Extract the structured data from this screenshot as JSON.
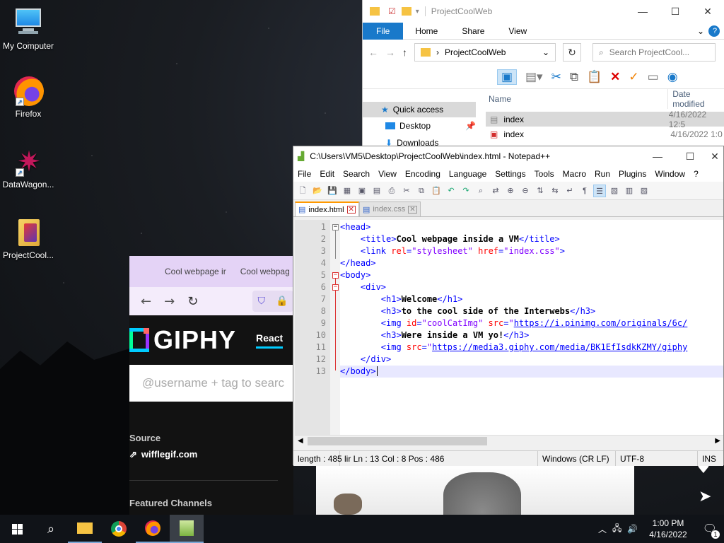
{
  "desktop": {
    "icons": [
      {
        "label": "My Computer"
      },
      {
        "label": "Firefox"
      },
      {
        "label": "DataWagon..."
      },
      {
        "label": "ProjectCool..."
      }
    ]
  },
  "firefox": {
    "tabs": [
      "Cool webpage ir",
      "Cool webpag"
    ],
    "giphy_logo": "GIPHY",
    "react_label": "React",
    "search_placeholder": "@username + tag to searc",
    "source_label": "Source",
    "source_link": "wifflegif.com",
    "featured_label": "Featured Channels"
  },
  "explorer": {
    "title": "ProjectCoolWeb",
    "ribbon_tabs": [
      "File",
      "Home",
      "Share",
      "View"
    ],
    "address": "ProjectCoolWeb",
    "search_placeholder": "Search ProjectCool...",
    "columns": {
      "name": "Name",
      "date": "Date modified"
    },
    "nav": [
      "Quick access",
      "Desktop",
      "Downloads"
    ],
    "files": [
      {
        "name": "index",
        "date": "4/16/2022 12:5"
      },
      {
        "name": "index",
        "date": "4/16/2022 1:0"
      }
    ]
  },
  "notepad": {
    "title": "C:\\Users\\VM5\\Desktop\\ProjectCoolWeb\\index.html - Notepad++",
    "menu": [
      "File",
      "Edit",
      "Search",
      "View",
      "Encoding",
      "Language",
      "Settings",
      "Tools",
      "Macro",
      "Run",
      "Plugins",
      "Window",
      "?"
    ],
    "tabs": [
      {
        "label": "index.html"
      },
      {
        "label": "index.css"
      }
    ],
    "line_numbers": [
      "1",
      "2",
      "3",
      "4",
      "5",
      "6",
      "7",
      "8",
      "9",
      "10",
      "11",
      "12",
      "13"
    ],
    "status": {
      "length": "length : 485",
      "pos": "lir Ln : 13    Col : 8    Pos : 486",
      "eol": "Windows (CR LF)",
      "encoding": "UTF-8",
      "mode": "INS"
    }
  },
  "taskbar": {
    "time": "1:00 PM",
    "date": "4/16/2022",
    "notifications": "1"
  }
}
